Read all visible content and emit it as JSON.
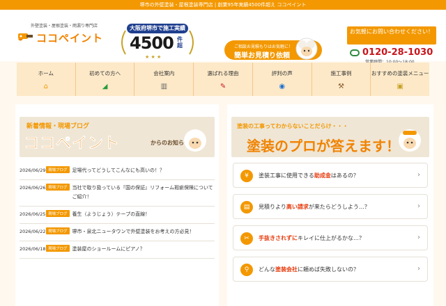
{
  "topbar": {
    "text": "堺市の外壁塗装・屋根塗装専門店 | 創業95年実績4500件超え ココペイント"
  },
  "header": {
    "logo_tagline": "外壁塗装・屋根塗装・雨漏り専門店",
    "logo_text": "ココペイント",
    "badge_top": "大阪府堺市で施工実績",
    "badge_number": "4500",
    "badge_unit": "件超",
    "badge_stars": "★ ★ ★",
    "quote_sub": "ご相談お見積もりはお気軽に！",
    "quote_main": "簡単お見積り依頼",
    "contact_box": "お気軽にお問い合わせください！",
    "phone": "0120-28-1030",
    "hours": "営業時間：10:00～18:00"
  },
  "nav": {
    "items": [
      {
        "label": "ホーム",
        "icon": "home-icon",
        "glyph": "⌂"
      },
      {
        "label": "初めての方へ",
        "icon": "beginner-icon",
        "glyph": "◢"
      },
      {
        "label": "会社案内",
        "icon": "building-icon",
        "glyph": "▥"
      },
      {
        "label": "選ばれる理由",
        "icon": "brush-icon",
        "glyph": "✎"
      },
      {
        "label": "評判の声",
        "icon": "speech-icon",
        "glyph": "◉"
      },
      {
        "label": "施工事例",
        "icon": "hammer-icon",
        "glyph": "⚒"
      },
      {
        "label": "おすすめの塗装メニュー",
        "icon": "paint-can-icon",
        "glyph": "▣"
      }
    ]
  },
  "news": {
    "hero_sub": "新着情報・現場ブログ",
    "hero_main": "ココペイント",
    "hero_suffix": "からのお知らせ",
    "items": [
      {
        "date": "2026/06/29",
        "tag": "現場ブログ",
        "title": "足場代ってどうしてこんなにも高いの！？"
      },
      {
        "date": "2026/06/26",
        "tag": "現場ブログ",
        "title": "当社で取り扱っている『国の保証』リフォーム瑕疵保険についてご紹介！"
      },
      {
        "date": "2026/06/25",
        "tag": "現場ブログ",
        "title": "養生（ようじょう）テープの直線！"
      },
      {
        "date": "2026/06/22",
        "tag": "現場ブログ",
        "title": "堺市・泉北ニュータウンで外壁塗装をお考えの方必見！"
      },
      {
        "date": "2026/06/18",
        "tag": "現場ブログ",
        "title": "塗装屋のショールームにピアノ？"
      }
    ]
  },
  "faq": {
    "hero_sub": "塗装の工事ってわからないことだらけ・・・",
    "hero_main": "塗装のプロが答えます！",
    "items": [
      {
        "icon": "yen-icon",
        "glyph": "¥",
        "pre": "塗装工事に使用できる",
        "hl": "助成金",
        "post": "はあるの？"
      },
      {
        "icon": "receipt-icon",
        "glyph": "▤",
        "pre": "見積りより",
        "hl": "高い請求",
        "post": "が来たらどうしよう…？"
      },
      {
        "icon": "tools-icon",
        "glyph": "✂",
        "pre": "",
        "hl": "手抜きされずに",
        "post": "キレイに仕上がるかな…？"
      },
      {
        "icon": "search-icon",
        "glyph": "⚲",
        "pre": "どんな",
        "hl": "塗装会社",
        "post": "に頼めば失敗しないの？"
      }
    ],
    "arrow": "›"
  }
}
